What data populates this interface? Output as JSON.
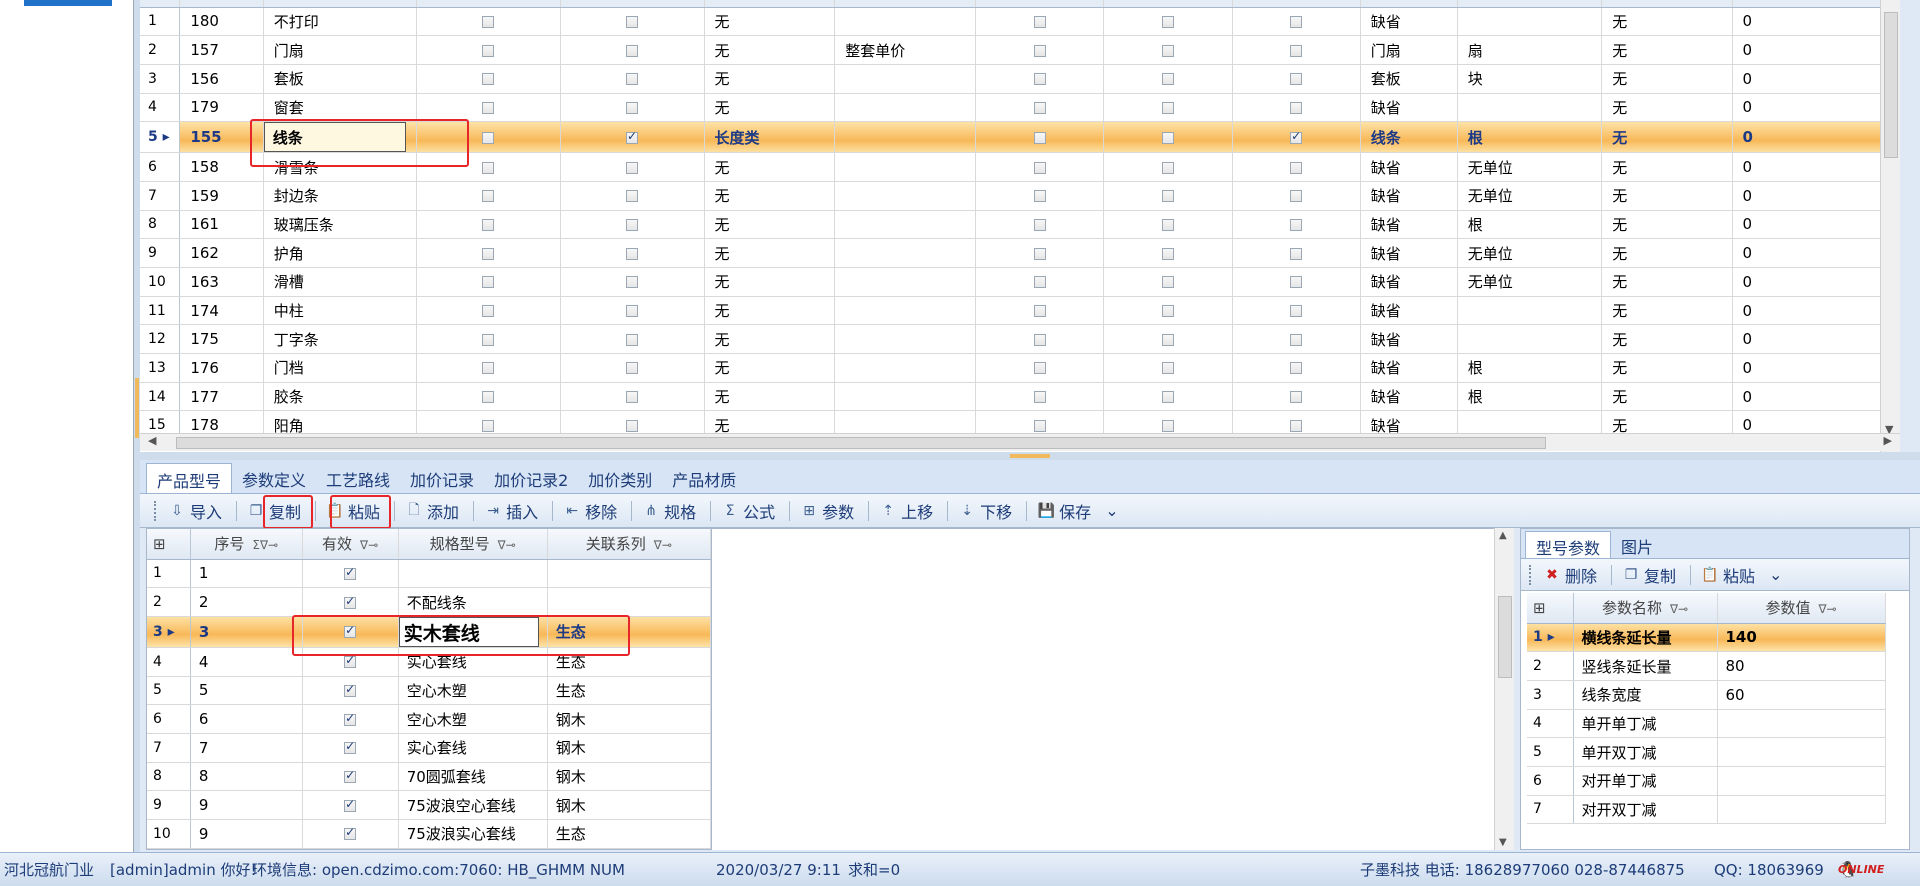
{
  "top_grid": {
    "rows": [
      {
        "n": "1",
        "id": "180",
        "name": "不打印",
        "c1": false,
        "c2": false,
        "cat": "无",
        "param": "",
        "c3": false,
        "c4": false,
        "c5": false,
        "series": "缺省",
        "unit": "",
        "calc": "无",
        "val": "0"
      },
      {
        "n": "2",
        "id": "157",
        "name": "门扇",
        "c1": false,
        "c2": false,
        "cat": "无",
        "param": "整套单价",
        "c3": false,
        "c4": false,
        "c5": false,
        "series": "门扇",
        "unit": "扇",
        "calc": "无",
        "val": "0"
      },
      {
        "n": "3",
        "id": "156",
        "name": "套板",
        "c1": false,
        "c2": false,
        "cat": "无",
        "param": "",
        "c3": false,
        "c4": false,
        "c5": false,
        "series": "套板",
        "unit": "块",
        "calc": "无",
        "val": "0"
      },
      {
        "n": "4",
        "id": "179",
        "name": "窗套",
        "c1": false,
        "c2": false,
        "cat": "无",
        "param": "",
        "c3": false,
        "c4": false,
        "c5": false,
        "series": "缺省",
        "unit": "",
        "calc": "无",
        "val": "0"
      },
      {
        "n": "5",
        "id": "155",
        "name": "线条",
        "c1": false,
        "c2": true,
        "cat": "长度类",
        "param": "",
        "c3": false,
        "c4": false,
        "c5": true,
        "series": "线条",
        "unit": "根",
        "calc": "无",
        "val": "0",
        "selected": true
      },
      {
        "n": "6",
        "id": "158",
        "name": "滑雪条",
        "c1": false,
        "c2": false,
        "cat": "无",
        "param": "",
        "c3": false,
        "c4": false,
        "c5": false,
        "series": "缺省",
        "unit": "无单位",
        "calc": "无",
        "val": "0"
      },
      {
        "n": "7",
        "id": "159",
        "name": "封边条",
        "c1": false,
        "c2": false,
        "cat": "无",
        "param": "",
        "c3": false,
        "c4": false,
        "c5": false,
        "series": "缺省",
        "unit": "无单位",
        "calc": "无",
        "val": "0"
      },
      {
        "n": "8",
        "id": "161",
        "name": "玻璃压条",
        "c1": false,
        "c2": false,
        "cat": "无",
        "param": "",
        "c3": false,
        "c4": false,
        "c5": false,
        "series": "缺省",
        "unit": "根",
        "calc": "无",
        "val": "0"
      },
      {
        "n": "9",
        "id": "162",
        "name": "护角",
        "c1": false,
        "c2": false,
        "cat": "无",
        "param": "",
        "c3": false,
        "c4": false,
        "c5": false,
        "series": "缺省",
        "unit": "无单位",
        "calc": "无",
        "val": "0"
      },
      {
        "n": "10",
        "id": "163",
        "name": "滑槽",
        "c1": false,
        "c2": false,
        "cat": "无",
        "param": "",
        "c3": false,
        "c4": false,
        "c5": false,
        "series": "缺省",
        "unit": "无单位",
        "calc": "无",
        "val": "0"
      },
      {
        "n": "11",
        "id": "174",
        "name": "中柱",
        "c1": false,
        "c2": false,
        "cat": "无",
        "param": "",
        "c3": false,
        "c4": false,
        "c5": false,
        "series": "缺省",
        "unit": "",
        "calc": "无",
        "val": "0"
      },
      {
        "n": "12",
        "id": "175",
        "name": "丁字条",
        "c1": false,
        "c2": false,
        "cat": "无",
        "param": "",
        "c3": false,
        "c4": false,
        "c5": false,
        "series": "缺省",
        "unit": "",
        "calc": "无",
        "val": "0"
      },
      {
        "n": "13",
        "id": "176",
        "name": "门档",
        "c1": false,
        "c2": false,
        "cat": "无",
        "param": "",
        "c3": false,
        "c4": false,
        "c5": false,
        "series": "缺省",
        "unit": "根",
        "calc": "无",
        "val": "0"
      },
      {
        "n": "14",
        "id": "177",
        "name": "胶条",
        "c1": false,
        "c2": false,
        "cat": "无",
        "param": "",
        "c3": false,
        "c4": false,
        "c5": false,
        "series": "缺省",
        "unit": "根",
        "calc": "无",
        "val": "0"
      },
      {
        "n": "15",
        "id": "178",
        "name": "阳角",
        "c1": false,
        "c2": false,
        "cat": "无",
        "param": "",
        "c3": false,
        "c4": false,
        "c5": false,
        "series": "缺省",
        "unit": "",
        "calc": "无",
        "val": "0"
      }
    ]
  },
  "tabs": [
    "产品型号",
    "参数定义",
    "工艺路线",
    "加价记录",
    "加价记录2",
    "加价类别",
    "产品材质"
  ],
  "toolbar": [
    {
      "icon": "import-icon",
      "glyph": "⇩",
      "label": "导入"
    },
    {
      "icon": "copy-icon",
      "glyph": "❐",
      "label": "复制"
    },
    {
      "icon": "paste-icon",
      "glyph": "📋",
      "label": "粘贴"
    },
    {
      "icon": "add-icon",
      "glyph": "🗋",
      "label": "添加"
    },
    {
      "icon": "insert-icon",
      "glyph": "⇥",
      "label": "插入"
    },
    {
      "icon": "remove-icon",
      "glyph": "⇤",
      "label": "移除"
    },
    {
      "icon": "spec-icon",
      "glyph": "⋔",
      "label": "规格"
    },
    {
      "icon": "formula-icon",
      "glyph": "Σ",
      "label": "公式"
    },
    {
      "icon": "params-icon",
      "glyph": "⊞",
      "label": "参数"
    },
    {
      "icon": "move-up-icon",
      "glyph": "⇡",
      "label": "上移"
    },
    {
      "icon": "move-down-icon",
      "glyph": "⇣",
      "label": "下移"
    },
    {
      "icon": "save-icon",
      "glyph": "💾",
      "label": "保存"
    }
  ],
  "sub_grid": {
    "headers": {
      "seq": "序号",
      "valid": "有效",
      "spec": "规格型号",
      "series": "关联系列"
    },
    "rows": [
      {
        "n": "1",
        "seq": "1",
        "valid": true,
        "spec": "",
        "series": ""
      },
      {
        "n": "2",
        "seq": "2",
        "valid": true,
        "spec": "不配线条",
        "series": ""
      },
      {
        "n": "3",
        "seq": "3",
        "valid": true,
        "spec": "实木套线",
        "series": "生态",
        "selected": true
      },
      {
        "n": "4",
        "seq": "4",
        "valid": true,
        "spec": "实心套线",
        "series": "生态"
      },
      {
        "n": "5",
        "seq": "5",
        "valid": true,
        "spec": "空心木塑",
        "series": "生态"
      },
      {
        "n": "6",
        "seq": "6",
        "valid": true,
        "spec": "空心木塑",
        "series": "钢木"
      },
      {
        "n": "7",
        "seq": "7",
        "valid": true,
        "spec": "实心套线",
        "series": "钢木"
      },
      {
        "n": "8",
        "seq": "8",
        "valid": true,
        "spec": "70圆弧套线",
        "series": "钢木"
      },
      {
        "n": "9",
        "seq": "9",
        "valid": true,
        "spec": "75波浪空心套线",
        "series": "钢木"
      },
      {
        "n": "10",
        "seq": "9",
        "valid": true,
        "spec": "75波浪实心套线",
        "series": "生态"
      }
    ]
  },
  "right_panel": {
    "tabs": [
      "型号参数",
      "图片"
    ],
    "toolbar": [
      {
        "icon": "delete-icon",
        "glyph": "✖",
        "label": "删除"
      },
      {
        "icon": "copy-icon",
        "glyph": "❐",
        "label": "复制"
      },
      {
        "icon": "paste-icon",
        "glyph": "📋",
        "label": "粘贴"
      }
    ],
    "headers": {
      "name": "参数名称",
      "value": "参数值"
    },
    "rows": [
      {
        "n": "1",
        "name": "横线条延长量",
        "value": "140",
        "selected": true
      },
      {
        "n": "2",
        "name": "竖线条延长量",
        "value": "80"
      },
      {
        "n": "3",
        "name": "线条宽度",
        "value": "60"
      },
      {
        "n": "4",
        "name": "单开单丁减",
        "value": ""
      },
      {
        "n": "5",
        "name": "单开双丁减",
        "value": ""
      },
      {
        "n": "6",
        "name": "对开单丁减",
        "value": ""
      },
      {
        "n": "7",
        "name": "对开双丁减",
        "value": ""
      }
    ]
  },
  "status": {
    "company": "河北冠航门业",
    "user": "[admin]admin 你好!",
    "env": "环境信息: open.cdzimo.com:7060: HB_GHMM NUM",
    "datetime": "2020/03/27 9:11",
    "sum": "求和=0",
    "vendor": "子墨科技 电话: 18628977060 028-87446875",
    "qq": "QQ: 18063969",
    "online": "ONLINE"
  }
}
